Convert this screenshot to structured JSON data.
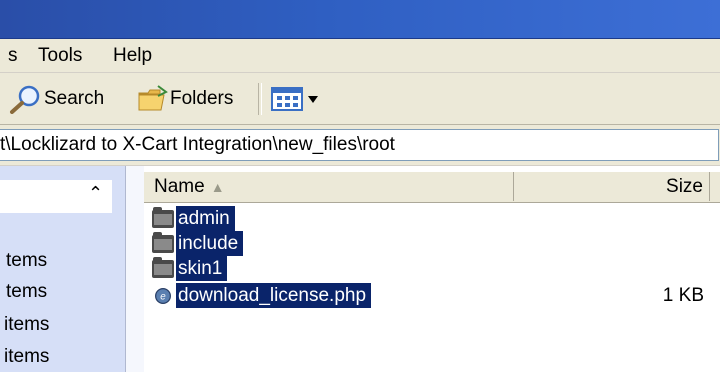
{
  "menu": {
    "items": [
      "s",
      "Tools",
      "Help"
    ]
  },
  "toolbar": {
    "search_label": "Search",
    "folders_label": "Folders",
    "views_icon": "views-grid-icon"
  },
  "address": {
    "path": "t\\Locklizard to X-Cart Integration\\new_files\\root"
  },
  "taskpane": {
    "collapse_icon": "double-chevron-up-icon",
    "items": [
      "tems",
      "tems",
      "items",
      "items"
    ]
  },
  "columns": {
    "name": "Name",
    "size": "Size"
  },
  "files": [
    {
      "name": "admin",
      "size": "",
      "icon": "folder-icon"
    },
    {
      "name": "include",
      "size": "",
      "icon": "folder-icon"
    },
    {
      "name": "skin1",
      "size": "",
      "icon": "folder-icon"
    },
    {
      "name": "download_license.php",
      "size": "1 KB",
      "icon": "php-file-icon"
    }
  ],
  "colors": {
    "titlebar": "#2f5fc2",
    "chrome": "#ece9d8",
    "selection": "#0a246a",
    "taskpane": "#d6dff7"
  }
}
